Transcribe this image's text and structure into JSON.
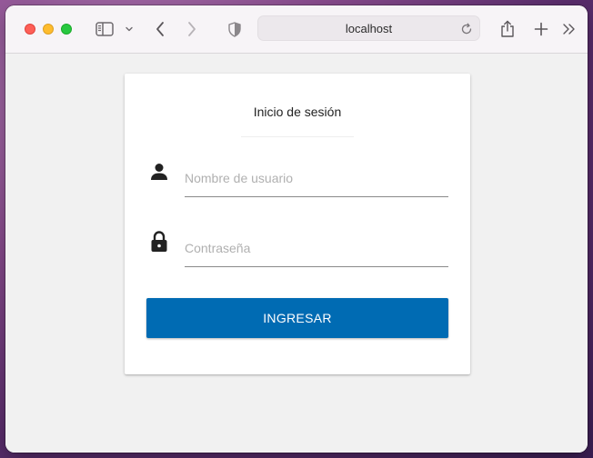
{
  "browser": {
    "address": "localhost",
    "icons": {
      "sidebar": "sidebar-toggle-icon",
      "sidebar_menu": "chevron-down-icon",
      "back": "chevron-left-icon",
      "forward": "chevron-right-icon",
      "privacy": "shield-icon",
      "reload": "reload-icon",
      "share": "share-icon",
      "new_tab": "plus-icon",
      "more": "double-chevron-right-icon"
    }
  },
  "login": {
    "title": "Inicio de sesión",
    "username_placeholder": "Nombre de usuario",
    "username_value": "",
    "password_placeholder": "Contraseña",
    "password_value": "",
    "submit_label": "INGRESAR",
    "icons": {
      "username": "user-icon",
      "password": "lock-icon"
    },
    "colors": {
      "primary": "#006bb3",
      "background": "#f1f1f1",
      "card": "#ffffff"
    }
  }
}
